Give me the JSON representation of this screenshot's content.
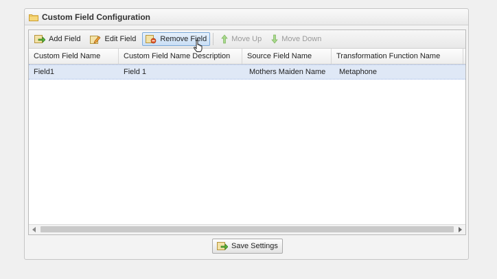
{
  "panel": {
    "title": "Custom Field Configuration"
  },
  "toolbar": {
    "add_label": "Add Field",
    "edit_label": "Edit Field",
    "remove_label": "Remove Field",
    "move_up_label": "Move Up",
    "move_down_label": "Move Down"
  },
  "grid": {
    "columns": [
      "Custom Field Name",
      "Custom Field Name Description",
      "Source Field Name",
      "Transformation Function Name"
    ],
    "rows": [
      [
        "Field1",
        "Field 1",
        "Mothers Maiden Name",
        "Metaphone"
      ]
    ]
  },
  "footer": {
    "save_label": "Save Settings"
  },
  "colors": {
    "selection": "#dfe8f6",
    "hover_border": "#7aa8d8",
    "disabled_arrow": "#8fcf6a"
  }
}
